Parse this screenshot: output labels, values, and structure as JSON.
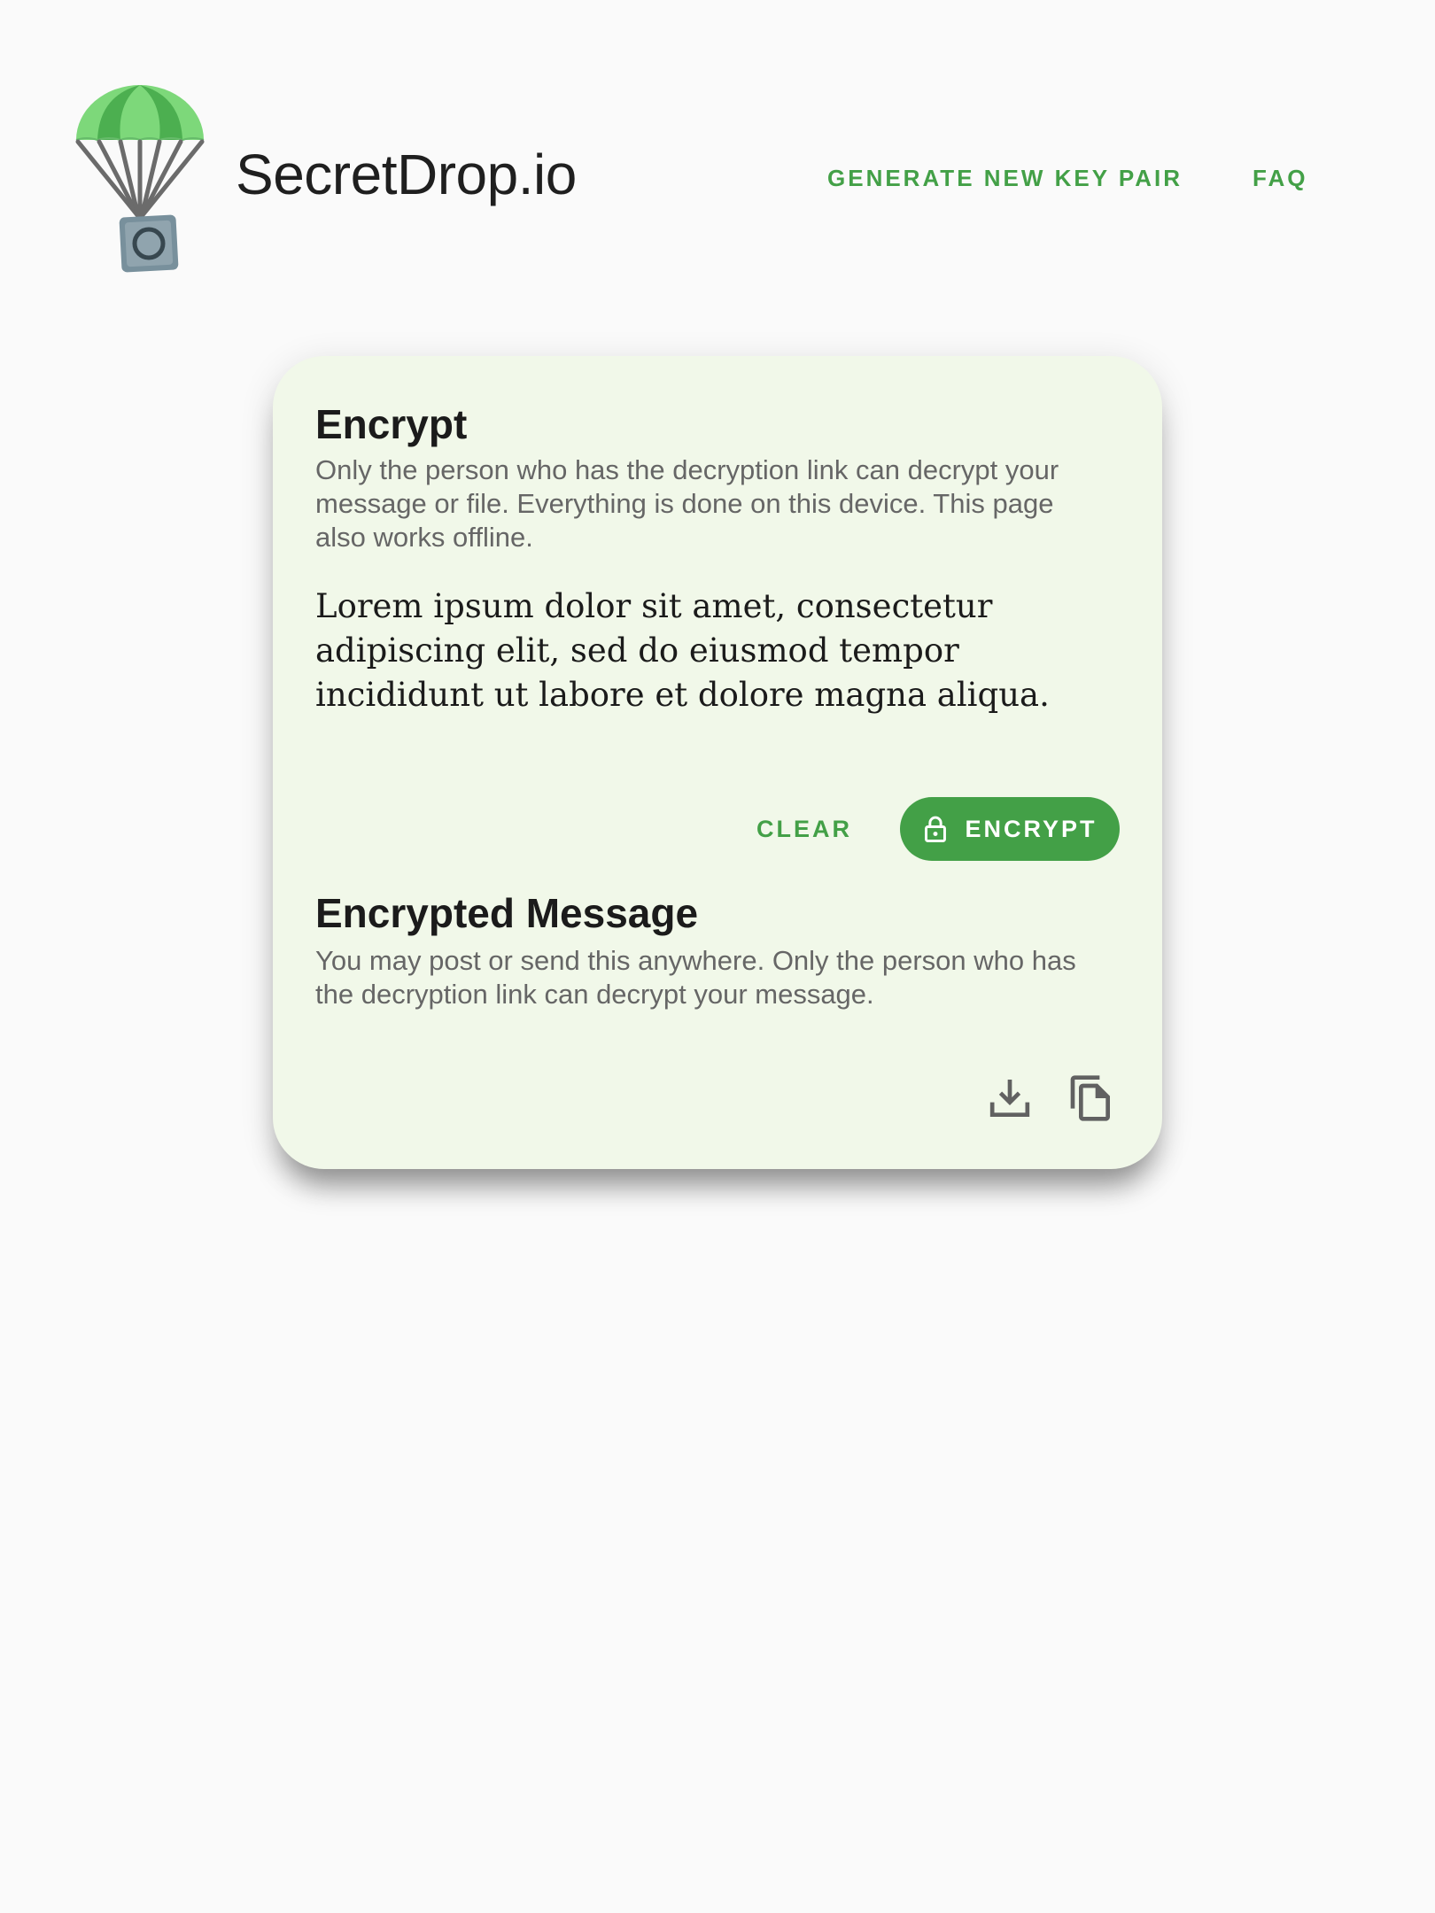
{
  "header": {
    "app_name": "SecretDrop.io",
    "nav": [
      {
        "label": "GENERATE NEW KEY PAIR"
      },
      {
        "label": "FAQ"
      }
    ]
  },
  "encrypt_section": {
    "title": "Encrypt",
    "description": "Only the person who has the decryption link can decrypt your message or file. Everything is done on this device. This page also works offline.",
    "message": "Lorem ipsum dolor sit amet, consectetur adipiscing elit, sed do eiusmod tempor incididunt ut labore et dolore magna aliqua.",
    "clear_label": "CLEAR",
    "encrypt_label": "ENCRYPT"
  },
  "result_section": {
    "title": "Encrypted Message",
    "description": "You may post or send this anywhere. Only the person who has the decryption link can decrypt your message."
  },
  "icons": {
    "logo": "parachute-safe-logo",
    "encrypt": "lock-icon",
    "download": "download-icon",
    "copy": "copy-icon"
  },
  "colors": {
    "accent": "#43a047",
    "card_background": "#f1f8e9",
    "page_background": "#fafafa"
  }
}
